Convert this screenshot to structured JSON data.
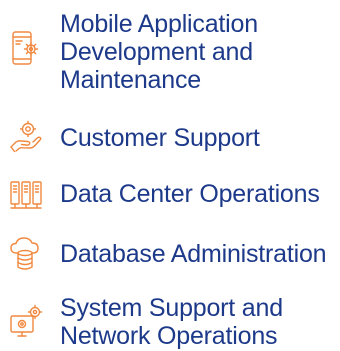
{
  "accent_color": "#f0883e",
  "text_color": "#1d3a8a",
  "services": [
    {
      "icon": "mobile-gear-icon",
      "lines": [
        "Mobile Application",
        "Development and",
        "Maintenance"
      ]
    },
    {
      "icon": "hand-gear-icon",
      "lines": [
        "Customer Support"
      ]
    },
    {
      "icon": "server-racks-icon",
      "lines": [
        "Data Center Operations"
      ]
    },
    {
      "icon": "cloud-database-icon",
      "lines": [
        "Database Administration"
      ]
    },
    {
      "icon": "monitor-gear-icon",
      "lines": [
        "System Support and",
        "Network Operations"
      ]
    }
  ]
}
